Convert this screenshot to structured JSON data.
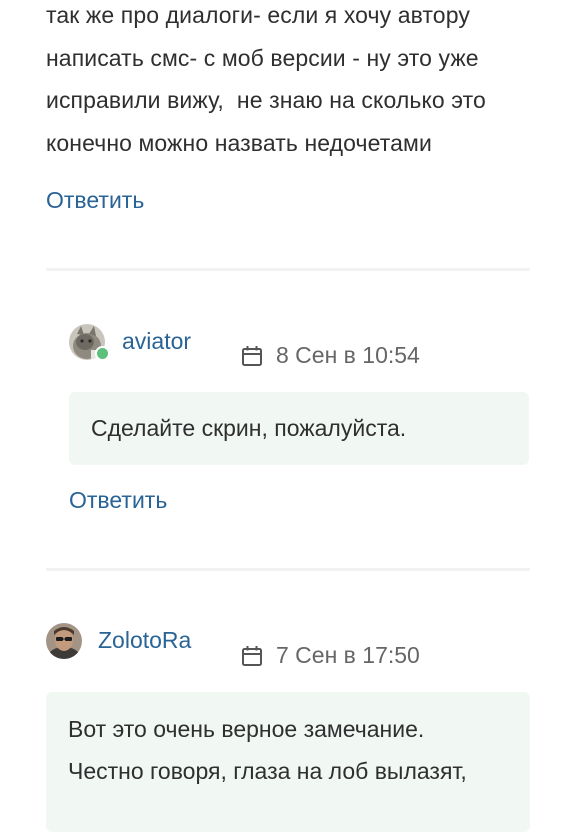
{
  "top_comment": {
    "text": "так же про диалоги- если я хочу автору\nнаписать смс- с моб версии - ну это уже\nисправили вижу,  не знаю на сколько это\nконечно можно назвать недочетами",
    "reply_label": "Ответить"
  },
  "comments": [
    {
      "author": "aviator",
      "date": "8 Сен в 10:54",
      "online": true,
      "text": "Сделайте скрин, пожалуйста.",
      "reply_label": "Ответить"
    },
    {
      "author": "ZolotoRa",
      "date": "7 Сен в 17:50",
      "online": false,
      "text_line1": "Вот это очень верное замечание.",
      "text_line2": "Честно говоря, глаза на лоб вылазят,"
    }
  ],
  "colors": {
    "link": "#2a6496",
    "bubble_bg": "#f1f8f4",
    "online": "#5cc07a",
    "muted": "#666666"
  },
  "icons": [
    "calendar-icon",
    "avatar-image"
  ]
}
